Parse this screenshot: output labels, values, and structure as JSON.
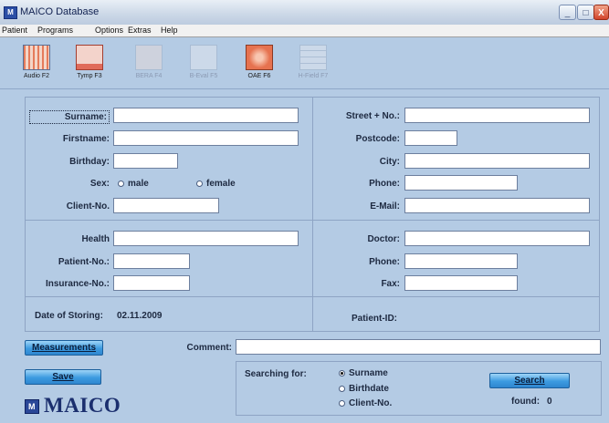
{
  "window": {
    "title": "MAICO Database",
    "min_label": "_",
    "max_label": "□",
    "close_label": "X"
  },
  "menu": {
    "items": [
      "Patient",
      "Programs",
      "Options",
      "Extras",
      "Help"
    ]
  },
  "toolbar": {
    "items": [
      {
        "label": "Audio F2",
        "icon": "audiogram-icon",
        "enabled": true,
        "color": "#e57b5b"
      },
      {
        "label": "Tymp F3",
        "icon": "tympanometry-icon",
        "enabled": true,
        "color": "#e06b5a"
      },
      {
        "label": "BERA F4",
        "icon": "bera-icon",
        "enabled": false,
        "color": "#c9b8b8"
      },
      {
        "label": "B-Eval F5",
        "icon": "b-eval-icon",
        "enabled": false,
        "color": "#c8d0db"
      },
      {
        "label": "OAE F6",
        "icon": "oae-icon",
        "enabled": true,
        "color": "#e6724f"
      },
      {
        "label": "H-Field F7",
        "icon": "h-field-icon",
        "enabled": false,
        "color": "#c8d0db"
      }
    ]
  },
  "patient": {
    "surname_label": "Surname:",
    "surname_value": "",
    "firstname_label": "Firstname:",
    "firstname_value": "",
    "birthday_label": "Birthday:",
    "birthday_value": "",
    "sex_label": "Sex:",
    "sex_male": "male",
    "sex_female": "female",
    "client_no_label": "Client-No.",
    "client_no_value": ""
  },
  "address": {
    "street_label": "Street + No.:",
    "street_value": "",
    "postcode_label": "Postcode:",
    "postcode_value": "",
    "city_label": "City:",
    "city_value": "",
    "phone_label": "Phone:",
    "phone_value": "",
    "email_label": "E-Mail:",
    "email_value": ""
  },
  "insurance": {
    "health_label": "Health",
    "health_value": "",
    "patient_no_label": "Patient-No.:",
    "patient_no_value": "",
    "insurance_no_label": "Insurance-No.:",
    "insurance_no_value": ""
  },
  "doctor": {
    "doctor_label": "Doctor:",
    "doctor_value": "",
    "phone_label": "Phone:",
    "phone_value": "",
    "fax_label": "Fax:",
    "fax_value": ""
  },
  "storing": {
    "label": "Date of Storing:",
    "value": "02.11.2009",
    "patient_id_label": "Patient-ID:"
  },
  "actions": {
    "measurements_label": "Measurements",
    "save_label": "Save",
    "comment_label": "Comment:",
    "comment_value": "",
    "search_label": "Search"
  },
  "search": {
    "title": "Searching for:",
    "options": [
      "Surname",
      "Birthdate",
      "Client-No."
    ],
    "selected": "Surname",
    "found_label": "found:",
    "found_count": "0"
  },
  "logo": {
    "text": "MAICO",
    "mark": "M"
  },
  "colors": {
    "background": "#b4cbe4",
    "button": "#3c9be0",
    "close_button": "#d2432a"
  }
}
